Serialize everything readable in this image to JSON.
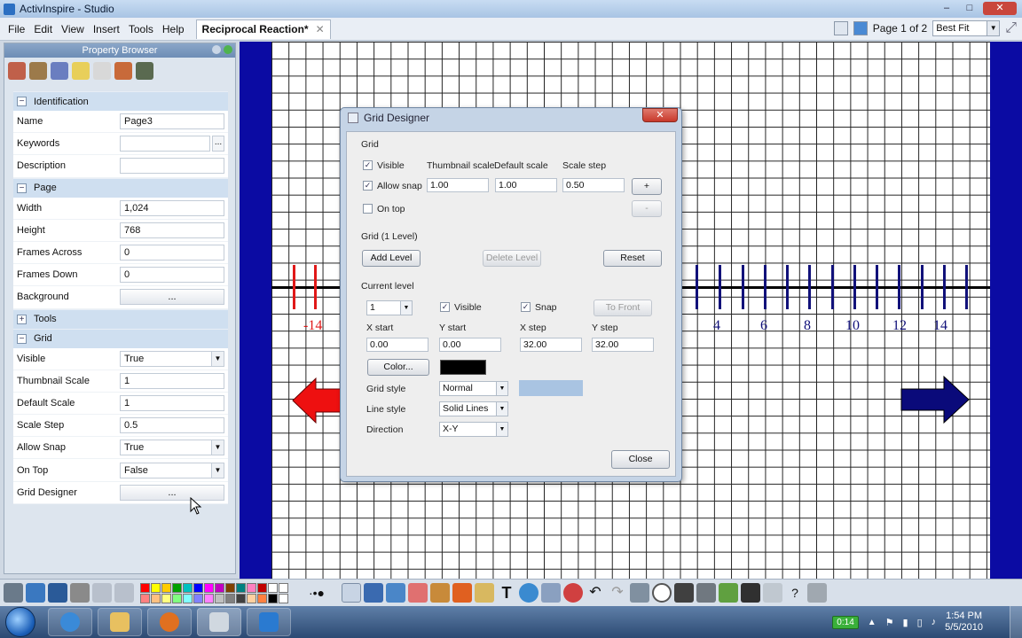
{
  "window": {
    "title": "ActivInspire - Studio",
    "controls": [
      "–",
      "□",
      "✕"
    ]
  },
  "menu": {
    "items": [
      "File",
      "Edit",
      "View",
      "Insert",
      "Tools",
      "Help"
    ],
    "doc_tab": "Reciprocal Reaction*",
    "doc_tab_close": "✕",
    "page_indicator": "Page 1 of 2",
    "zoom": "Best Fit"
  },
  "property_browser": {
    "title": "Property Browser",
    "sections": {
      "identification": "Identification",
      "page": "Page",
      "tools": "Tools",
      "grid": "Grid"
    },
    "identification": [
      {
        "key": "Name",
        "value": "Page3"
      },
      {
        "key": "Keywords",
        "value": "",
        "extra": "..."
      },
      {
        "key": "Description",
        "value": ""
      }
    ],
    "page": [
      {
        "key": "Width",
        "value": "1,024"
      },
      {
        "key": "Height",
        "value": "768"
      },
      {
        "key": "Frames Across",
        "value": "0"
      },
      {
        "key": "Frames Down",
        "value": "0"
      },
      {
        "key": "Background",
        "value": "..."
      }
    ],
    "grid": [
      {
        "key": "Visible",
        "value": "True"
      },
      {
        "key": "Thumbnail Scale",
        "value": "1"
      },
      {
        "key": "Default Scale",
        "value": "1"
      },
      {
        "key": "Scale Step",
        "value": "0.5"
      },
      {
        "key": "Allow Snap",
        "value": "True"
      },
      {
        "key": "On Top",
        "value": "False"
      },
      {
        "key": "Grid Designer",
        "value": "..."
      }
    ]
  },
  "number_line": {
    "labels": [
      "-14",
      "4",
      "6",
      "8",
      "10",
      "12",
      "14"
    ]
  },
  "grid_designer": {
    "title": "Grid Designer",
    "close_x": "✕",
    "grid_group": "Grid",
    "visible": "Visible",
    "allow_snap": "Allow snap",
    "on_top": "On top",
    "thumbnail_scale_label": "Thumbnail scale",
    "default_scale_label": "Default scale",
    "scale_step_label": "Scale step",
    "thumbnail_scale": "1.00",
    "default_scale": "1.00",
    "scale_step": "0.50",
    "plus": "+",
    "minus": "-",
    "grid_level_group": "Grid (1 Level)",
    "add_level": "Add Level",
    "delete_level": "Delete Level",
    "reset": "Reset",
    "current_level_label": "Current level",
    "current_level": "1",
    "level_visible": "Visible",
    "level_snap": "Snap",
    "to_front": "To Front",
    "x_start_label": "X start",
    "y_start_label": "Y start",
    "x_step_label": "X step",
    "y_step_label": "Y step",
    "x_start": "0.00",
    "y_start": "0.00",
    "x_step": "32.00",
    "y_step": "32.00",
    "color_button": "Color...",
    "color_value": "#000000",
    "grid_style_label": "Grid style",
    "grid_style": "Normal",
    "line_style_label": "Line style",
    "line_style": "Solid Lines",
    "direction_label": "Direction",
    "direction": "X-Y",
    "close_button": "Close"
  },
  "taskbar": {
    "timer": "0:14",
    "time": "1:54 PM",
    "date": "5/5/2010"
  },
  "colors": {
    "canvas_border": "#0b0ba3",
    "negative": "#e01818",
    "positive": "#11117a",
    "palette": [
      "#ff0000",
      "#ffff00",
      "#ffff00",
      "#00a000",
      "#00ffff",
      "#0000ff",
      "#ff00ff",
      "#800080",
      "#804000",
      "#008080",
      "#000000",
      "#ff8080",
      "#ffc080",
      "#c0c0c0"
    ]
  }
}
